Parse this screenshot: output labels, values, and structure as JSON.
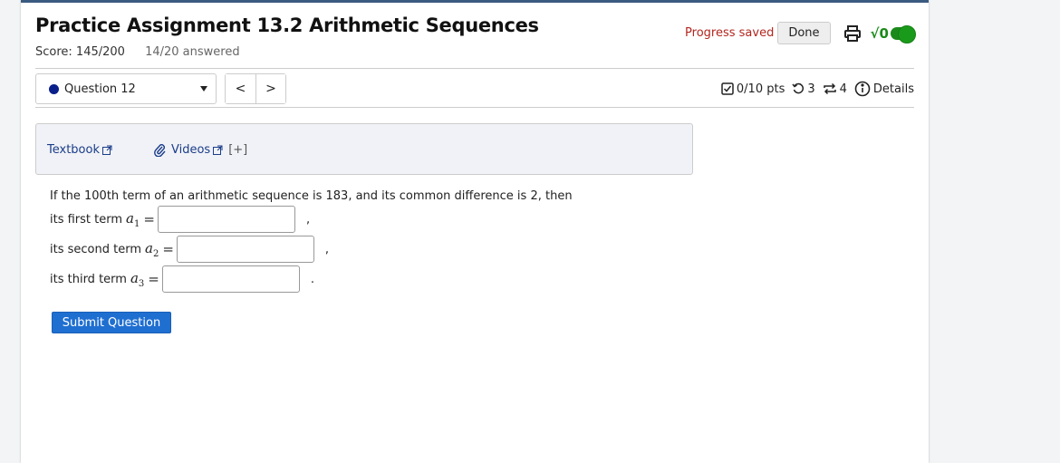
{
  "header": {
    "title": "Practice Assignment 13.2 Arithmetic Sequences",
    "score": "Score: 145/200",
    "answered": "14/20 answered",
    "progress_saved": "Progress saved",
    "done_label": "Done",
    "sqrt_label": "√0"
  },
  "question_nav": {
    "selected": "Question 12",
    "prev_label": "<",
    "next_label": ">"
  },
  "meta": {
    "points": "0/10 pts",
    "retries": "3",
    "attempts": "4",
    "details_label": "Details"
  },
  "resources": {
    "textbook_label": "Textbook",
    "videos_label": "Videos",
    "expand_label": "[+]"
  },
  "question": {
    "text": "If the 100th term of an arithmetic sequence is 183, and its common difference is 2, then",
    "rows": [
      {
        "prefix": "its first term",
        "var": "a",
        "sub": "1",
        "eq": "=",
        "value": "",
        "punct": ","
      },
      {
        "prefix": "its second term",
        "var": "a",
        "sub": "2",
        "eq": "=",
        "value": "",
        "punct": ","
      },
      {
        "prefix": "its third term",
        "var": "a",
        "sub": "3",
        "eq": "=",
        "value": "",
        "punct": "."
      }
    ],
    "submit_label": "Submit Question"
  },
  "colors": {
    "accent": "#1f6fd1",
    "saved": "#b3261e",
    "toggle": "#1a8a1a",
    "question_dot": "#0a1f8a"
  }
}
